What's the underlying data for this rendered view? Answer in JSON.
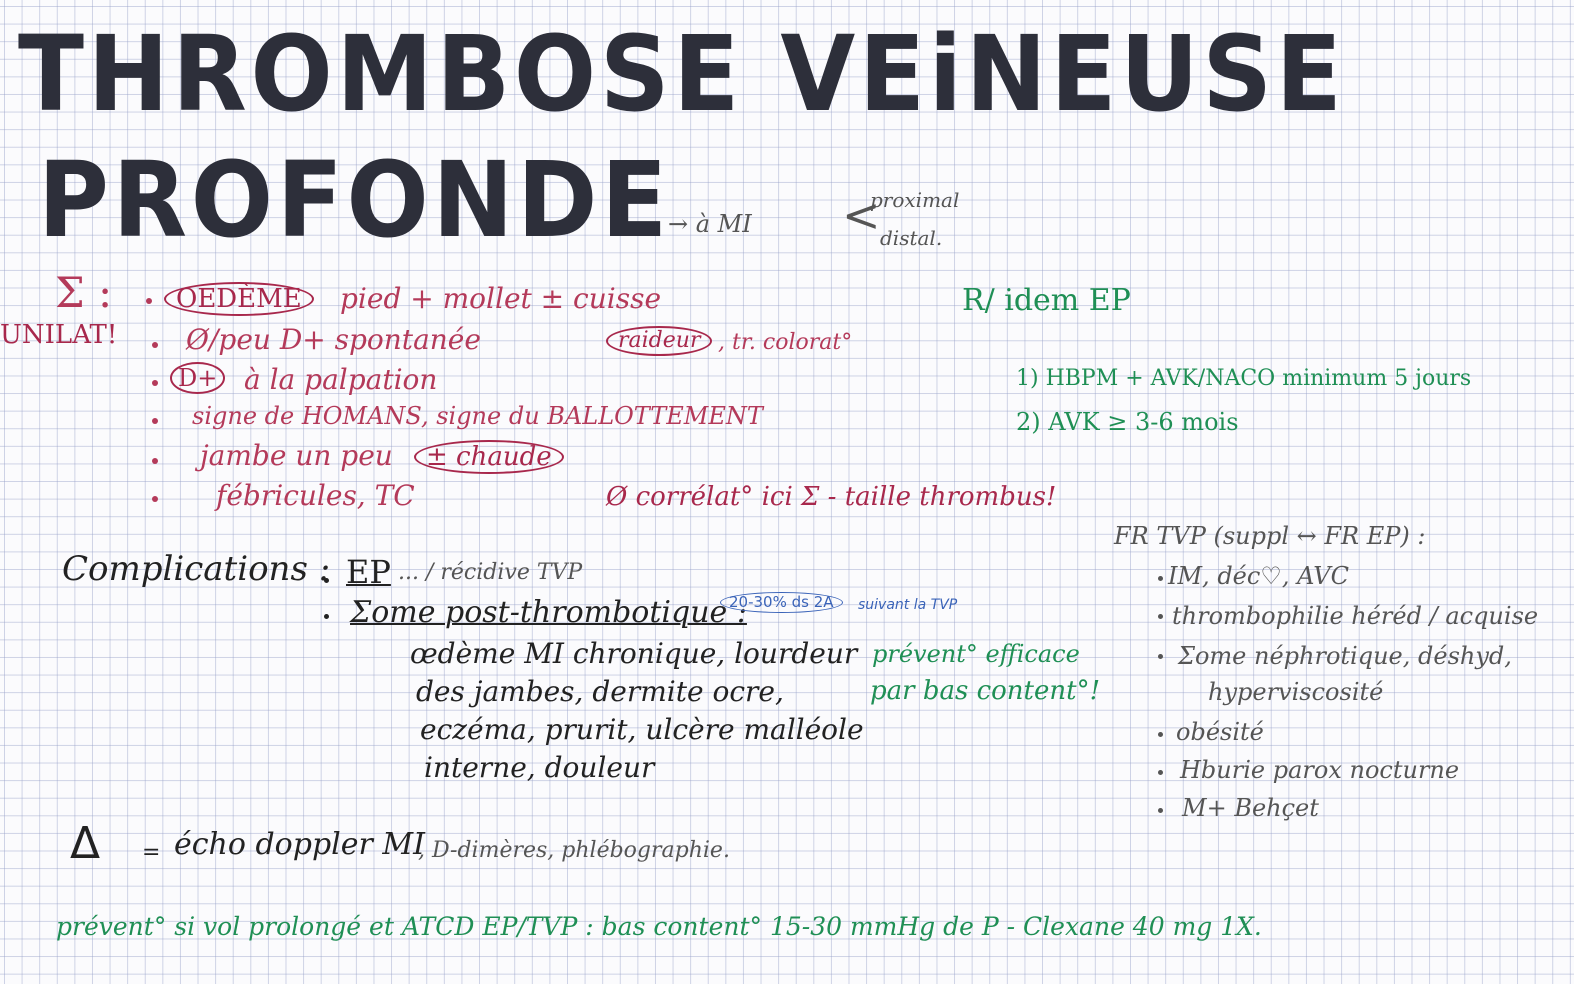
{
  "title": {
    "line1": "THROMBOSE VEiNEUSE",
    "line2": "PROFONDE"
  },
  "localisation": {
    "arrow": "→ à MI",
    "proximal": "proximal",
    "distal": "distal."
  },
  "symptoms": {
    "sigma": "Σ :",
    "unilat": "UNILAT!",
    "oedeme": "OEDÈME",
    "oedeme_rest": "pied + mollet ± cuisse",
    "item2": "Ø/peu D+ spontanée",
    "raideur": "raideur",
    "item2_end": ", tr. colorat°",
    "dplus": "D+",
    "item3_rest": "à la palpation",
    "item4": "signe de HOMANS, signe du BALLOTTEMENT",
    "item5": "jambe un peu",
    "chaude": "± chaude",
    "item6": "fébricules, TC",
    "correl": "Ø corrélat° ici Σ - taille thrombus!"
  },
  "treatment": {
    "heading": "R/ idem EP",
    "item1": "1) HBPM + AVK/NACO minimum 5 jours",
    "item2": "2) AVK ≥ 3-6 mois"
  },
  "complications": {
    "label": "Complications :",
    "ep": "EP",
    "ep_note": "... / récidive TVP",
    "sepost": "Σome post-thrombotique :",
    "sepost_note": "20-30% ds 2A",
    "sepost_note2": "suivant la TVP",
    "body1": "œdème MI chronique, lourdeur",
    "body2": "des jambes, dermite ocre,",
    "body3": "eczéma, prurit, ulcère malléole",
    "body4": "interne, douleur",
    "prev1": "prévent° efficace",
    "prev2": "par bas content°!"
  },
  "risk_factors": {
    "heading": "FR TVP (suppl ↔ FR EP) :",
    "items": [
      "IM, déc♡, AVC",
      "thrombophilie héréd / acquise",
      "Σome néphrotique, déshyd,",
      "hyperviscosité",
      "obésité",
      "Hburie parox nocturne",
      "M+ Behçet"
    ]
  },
  "diagnosis": {
    "symbol": "Δ",
    "eq": "=",
    "main": "écho doppler MI",
    "rest": ", D-dimères, phlébographie."
  },
  "footer": "prévent° si vol prolongé et ATCD EP/TVP : bas content° 15-30 mmHg de P - Clexane 40 mg 1X.",
  "colors": {
    "pink": "#b43a5a",
    "green": "#1f8f55",
    "ink": "#2d2f3a",
    "blue": "#3a63b8"
  }
}
